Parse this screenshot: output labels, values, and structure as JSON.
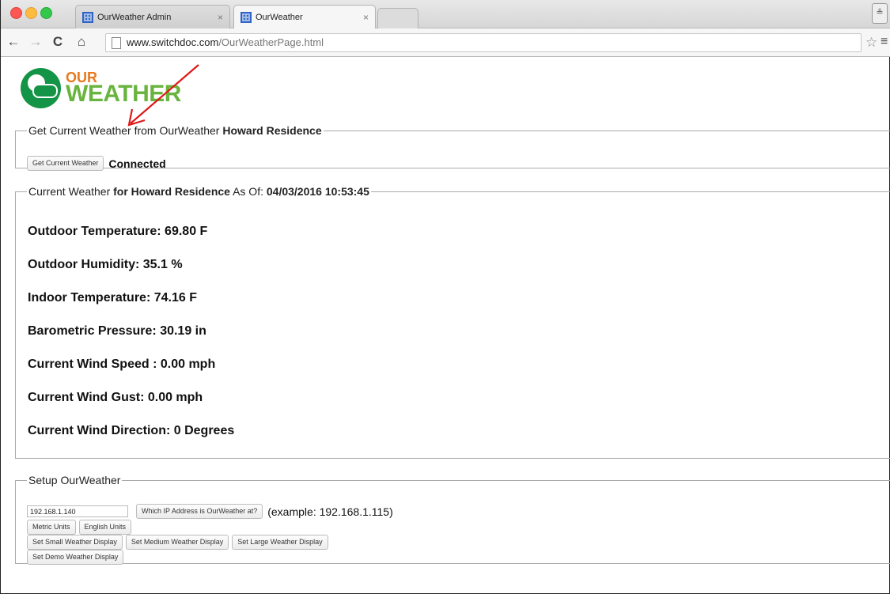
{
  "browser": {
    "tabs": [
      {
        "label": "OurWeather Admin",
        "active": false
      },
      {
        "label": "OurWeather",
        "active": true
      }
    ],
    "url_domain": "www.switchdoc.com",
    "url_path": "/OurWeatherPage.html"
  },
  "logo": {
    "line1": "OUR",
    "line2": "WEATHER"
  },
  "section_get": {
    "legend_prefix": "Get Current Weather from OurWeather",
    "legend_station": "Howard Residence",
    "button_label": "Get Current Weather",
    "status": "Connected"
  },
  "section_current": {
    "legend_prefix": "Current Weather",
    "legend_station": "for Howard Residence",
    "legend_asof": "As Of:",
    "legend_timestamp": "04/03/2016 10:53:45",
    "readings": [
      "Outdoor Temperature: 69.80 F",
      "Outdoor Humidity: 35.1 %",
      "Indoor Temperature: 74.16 F",
      "Barometric Pressure: 30.19 in",
      "Current Wind Speed : 0.00 mph",
      "Current Wind Gust: 0.00 mph",
      "Current Wind Direction: 0 Degrees"
    ]
  },
  "section_setup": {
    "legend": "Setup OurWeather",
    "ip_value": "192.168.1.140",
    "ip_button": "Which IP Address is OurWeather at?",
    "example": "(example: 192.168.1.115)",
    "metric_button": "Metric Units",
    "english_button": "English Units",
    "small_button": "Set Small Weather Display",
    "medium_button": "Set Medium Weather Display",
    "large_button": "Set Large Weather Display",
    "demo_button": "Set Demo Weather Display"
  },
  "colors": {
    "annotation_arrow": "#e01818",
    "logo_green": "#149447",
    "logo_orange": "#e87a1e"
  },
  "icons": [
    "back-arrow-icon",
    "forward-arrow-icon",
    "reload-icon",
    "home-icon",
    "page-icon",
    "star-icon",
    "menu-icon"
  ]
}
